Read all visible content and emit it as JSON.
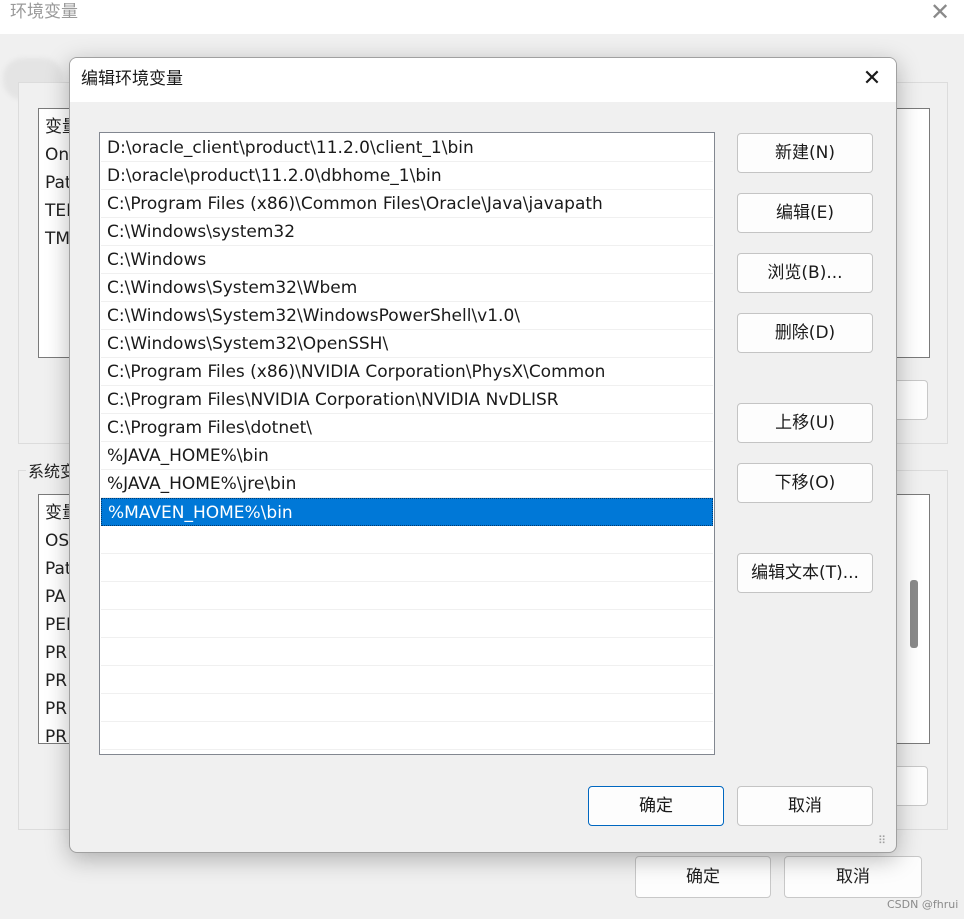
{
  "background_window": {
    "title": "环境变量",
    "close_glyph": "✕",
    "user_list_rows": [
      "变量",
      "On",
      "Pat",
      "TEI",
      "TM"
    ],
    "system_group_label": "系统变",
    "system_list_rows": [
      "变量",
      "OS",
      "Pat",
      "PA",
      "PEI",
      "PR",
      "PR",
      "PR",
      "PR"
    ],
    "ok_label": "确定",
    "cancel_label": "取消"
  },
  "dialog": {
    "title": "编辑环境变量",
    "close_glyph": "✕",
    "entries": [
      "D:\\oracle_client\\product\\11.2.0\\client_1\\bin",
      "D:\\oracle\\product\\11.2.0\\dbhome_1\\bin",
      "C:\\Program Files (x86)\\Common Files\\Oracle\\Java\\javapath",
      "C:\\Windows\\system32",
      "C:\\Windows",
      "C:\\Windows\\System32\\Wbem",
      "C:\\Windows\\System32\\WindowsPowerShell\\v1.0\\",
      "C:\\Windows\\System32\\OpenSSH\\",
      "C:\\Program Files (x86)\\NVIDIA Corporation\\PhysX\\Common",
      "C:\\Program Files\\NVIDIA Corporation\\NVIDIA NvDLISR",
      "C:\\Program Files\\dotnet\\",
      "%JAVA_HOME%\\bin",
      "%JAVA_HOME%\\jre\\bin",
      "%MAVEN_HOME%\\bin"
    ],
    "selected_index": 13,
    "buttons": {
      "new": "新建(N)",
      "edit": "编辑(E)",
      "browse": "浏览(B)...",
      "delete": "删除(D)",
      "move_up": "上移(U)",
      "move_down": "下移(O)",
      "edit_text": "编辑文本(T)...",
      "ok": "确定",
      "cancel": "取消"
    }
  },
  "watermark": "CSDN @fhrui",
  "colors": {
    "selection": "#0078d7",
    "primary_border": "#0067c0"
  }
}
